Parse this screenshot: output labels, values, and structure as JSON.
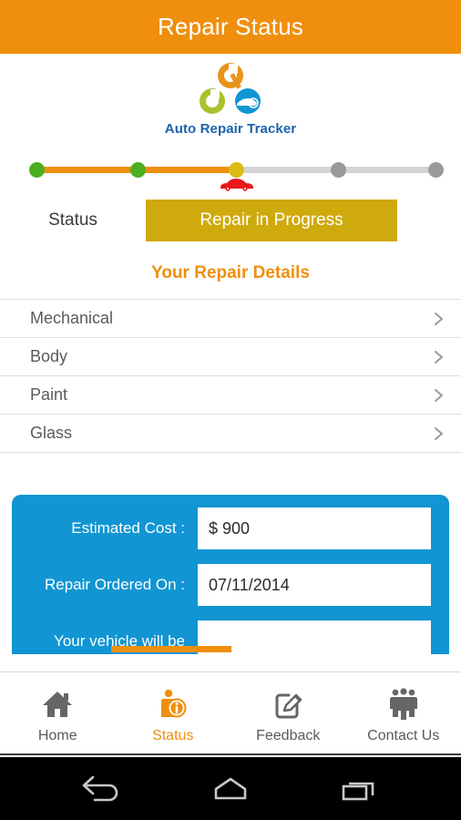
{
  "titlebar": {
    "title": "Repair Status"
  },
  "logo": {
    "name": "Auto Repair Tracker",
    "colors": {
      "wrench_top": "#e8941a",
      "wrench_left": "#a8c32b",
      "car_circle": "#1195d3"
    }
  },
  "tracker": {
    "steps": [
      {
        "index": 1,
        "state": "complete",
        "color": "#4caf1f"
      },
      {
        "index": 2,
        "state": "complete",
        "color": "#4caf1f"
      },
      {
        "index": 3,
        "state": "current",
        "color": "#d9bb11"
      },
      {
        "index": 4,
        "state": "pending",
        "color": "#9a9a9a"
      },
      {
        "index": 5,
        "state": "pending",
        "color": "#9a9a9a"
      }
    ],
    "line_done_color": "#ef8f0d",
    "line_todo_color": "#d4d4d4",
    "marker_icon": "car-icon",
    "marker_color": "#e8191c"
  },
  "status": {
    "label": "Status",
    "value": "Repair in Progress",
    "pill_color": "#cfaa0d"
  },
  "details": {
    "heading": "Your Repair Details",
    "heading_color": "#ef8f0d",
    "items": [
      {
        "label": "Mechanical",
        "icon": "chevron-right-icon"
      },
      {
        "label": "Body",
        "icon": "chevron-right-icon"
      },
      {
        "label": "Paint",
        "icon": "chevron-right-icon"
      },
      {
        "label": "Glass",
        "icon": "chevron-right-icon"
      }
    ]
  },
  "card": {
    "bg_color": "#1195d3",
    "fields": [
      {
        "label": "Estimated Cost :",
        "value": "$ 900"
      },
      {
        "label": "Repair Ordered On :",
        "value": "07/11/2014"
      },
      {
        "label": "Your vehicle will be",
        "value": ""
      }
    ]
  },
  "tabbar": {
    "tabs": [
      {
        "label": "Home",
        "icon": "home-icon",
        "active": false
      },
      {
        "label": "Status",
        "icon": "status-person-info-icon",
        "active": true
      },
      {
        "label": "Feedback",
        "icon": "pencil-edit-icon",
        "active": false
      },
      {
        "label": "Contact Us",
        "icon": "people-group-icon",
        "active": false
      }
    ],
    "active_color": "#ef8f0d",
    "inactive_color": "#5a5a5a"
  },
  "sysbar": {
    "buttons": [
      {
        "name": "back-button",
        "icon": "back-arrow-icon"
      },
      {
        "name": "home-button",
        "icon": "home-pentagon-icon"
      },
      {
        "name": "recents-button",
        "icon": "recents-squares-icon"
      }
    ]
  }
}
